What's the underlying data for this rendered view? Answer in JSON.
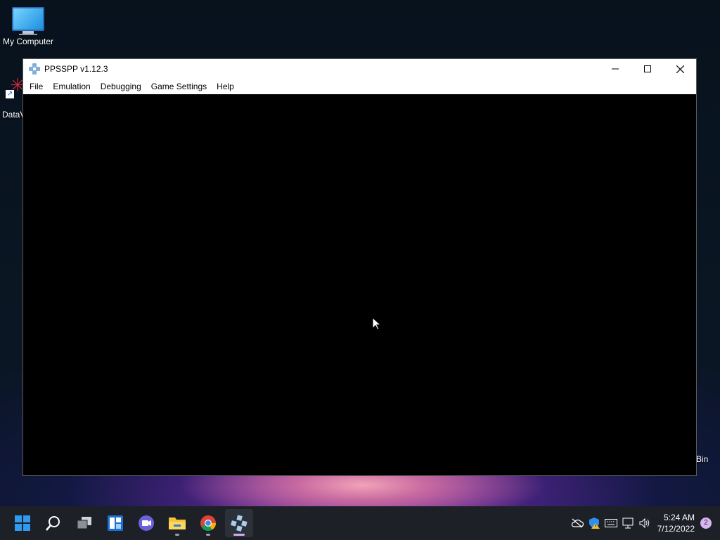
{
  "desktop": {
    "icons": [
      {
        "label": "My Computer",
        "icon": "monitor-icon"
      },
      {
        "label": "DataV",
        "icon": "datav-shortcut-icon"
      },
      {
        "label": "Bin",
        "icon": "recycle-bin-icon"
      }
    ]
  },
  "window": {
    "title": "PPSSPP v1.12.3",
    "controls": {
      "minimize": "—",
      "maximize": "☐",
      "close": "✕"
    },
    "menu": [
      "File",
      "Emulation",
      "Debugging",
      "Game Settings",
      "Help"
    ]
  },
  "taskbar": {
    "apps": [
      "start-icon",
      "search-icon",
      "task-view-icon",
      "widgets-icon",
      "teams-chat-icon",
      "file-explorer-icon",
      "chrome-icon",
      "ppsspp-icon"
    ],
    "clock": {
      "time": "5:24 AM",
      "date": "7/12/2022"
    },
    "notification_count": "2"
  },
  "colors": {
    "accent": "#0078d4",
    "taskbar": "#1d2026"
  }
}
